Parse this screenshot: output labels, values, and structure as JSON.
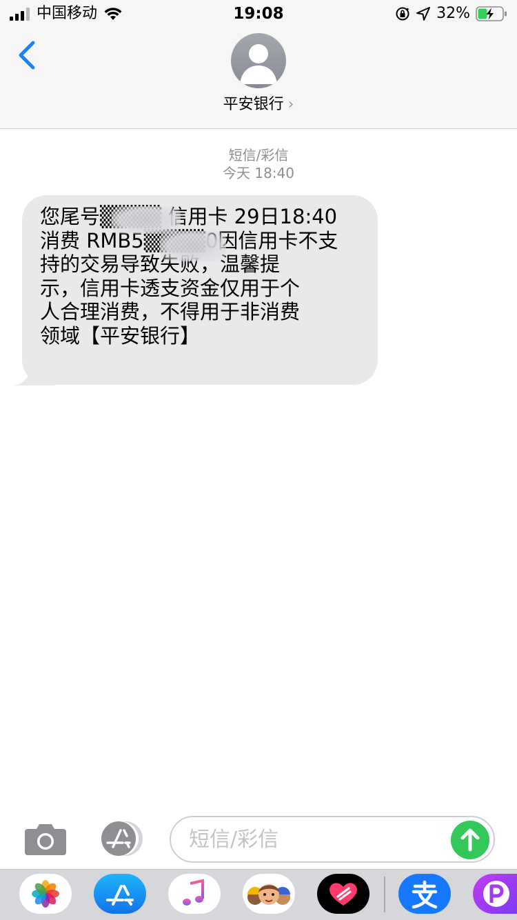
{
  "status_bar": {
    "carrier": "中国移动",
    "time": "19:08",
    "battery_percent": "32%"
  },
  "header": {
    "contact_name": "平安银行",
    "contact_chevron": "›"
  },
  "conversation": {
    "meta_type": "短信/彩信",
    "meta_time": "今天 18:40",
    "message_lines": [
      "您尾号▒▒▒▒ 信用卡 29日18:40",
      "消费 RMB5▒▒▒▒0因信用卡不支",
      "持的交易导致失败，温馨提",
      "示，信用卡透支资金仅用于个",
      "人合理消费，不得用于非消费",
      "领域【平安银行】"
    ]
  },
  "compose": {
    "placeholder": "短信/彩信"
  },
  "app_drawer": {
    "apps": [
      "photos-icon",
      "app-store-icon",
      "music-icon",
      "memoji-icon",
      "heart-app-icon",
      "alipay-icon",
      "p-app-icon"
    ]
  },
  "colors": {
    "ios_blue": "#1a82fb",
    "bubble_gray": "#e9e9eb",
    "send_green": "#34c759"
  }
}
